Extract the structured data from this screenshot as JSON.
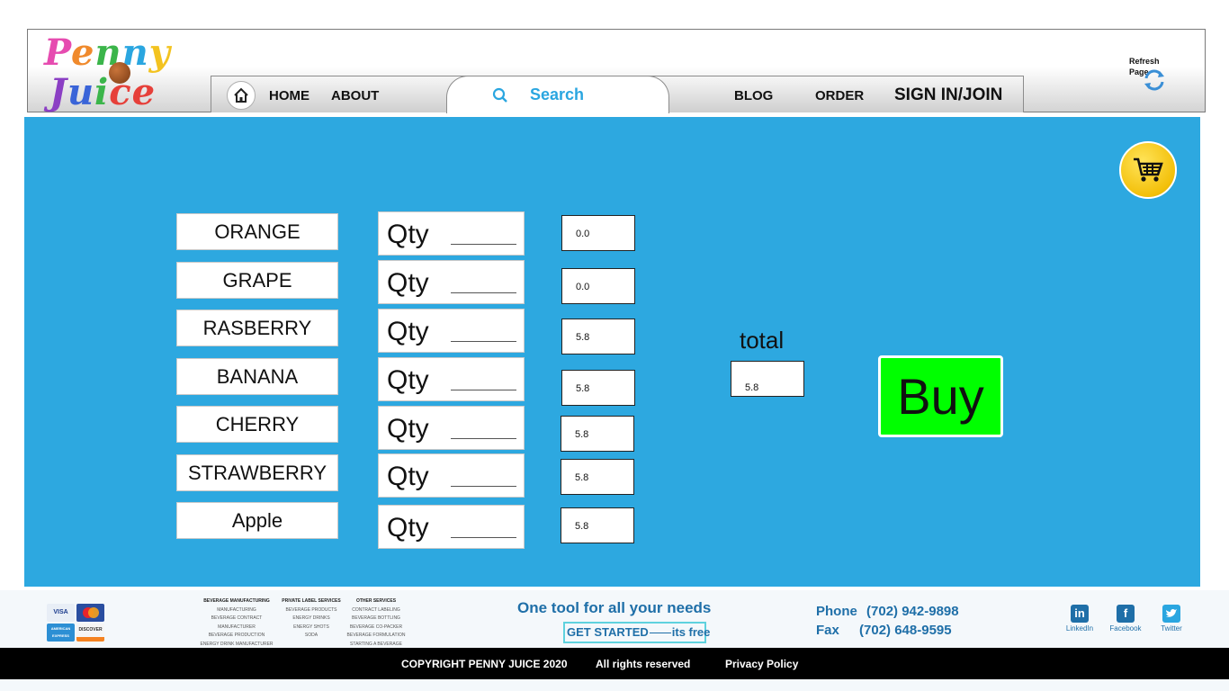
{
  "logo": {
    "line1": "Penny",
    "line2": "Juice"
  },
  "nav": {
    "home": "HOME",
    "about": "ABOUT",
    "search_label": "Search",
    "blog": "BLOG",
    "order": "ORDER",
    "sign_in": "SIGN IN/JOIN"
  },
  "refresh": {
    "line1": "Refresh",
    "line2": "Page"
  },
  "products": [
    {
      "name": "ORANGE",
      "qty_label": "Qty",
      "price": "0.0"
    },
    {
      "name": "GRAPE",
      "qty_label": "Qty",
      "price": "0.0"
    },
    {
      "name": "RASBERRY",
      "qty_label": "Qty",
      "price": "5.8"
    },
    {
      "name": "BANANA",
      "qty_label": "Qty",
      "price": "5.8"
    },
    {
      "name": "CHERRY",
      "qty_label": "Qty",
      "price": "5.8"
    },
    {
      "name": "STRAWBERRY",
      "qty_label": "Qty",
      "price": "5.8"
    },
    {
      "name": "Apple",
      "qty_label": "Qty",
      "price": "5.8"
    }
  ],
  "total": {
    "label": "total",
    "value": "5.8"
  },
  "buy_label": "Buy",
  "footer": {
    "col1": {
      "title": "BEVERAGE MANUFACTURING",
      "items": [
        "MANUFACTURING",
        "BEVERAGE CONTRACT MANUFACTURER",
        "BEVERAGE PRODUCTION",
        "ENERGY DRINK MANUFACTURER"
      ]
    },
    "col2": {
      "title": "PRIVATE LABEL SERVICES",
      "items": [
        "BEVERAGE PRODUCTS",
        "ENERGY DRINKS",
        "ENERGY SHOTS",
        "SODA"
      ]
    },
    "col3": {
      "title": "OTHER SERVICES",
      "items": [
        "CONTRACT LABELING",
        "BEVERAGE BOTTLING",
        "BEVERAGE CO-PACKER",
        "BEVERAGE FORMULATION",
        "STARTING A BEVERAGE BRAND"
      ]
    },
    "tagline": "One tool for all your needs",
    "get_started": "GET STARTED",
    "its_free": "its free",
    "phone_label": "Phone",
    "phone": "(702) 942-9898",
    "fax_label": "Fax",
    "fax": "(702) 648-9595",
    "social": {
      "linkedin": "LinkedIn",
      "facebook": "Facebook",
      "twitter": "Twitter"
    },
    "cards": {
      "visa": "VISA",
      "amex": "AMERICAN EXPRESS",
      "discover": "DISCOVER"
    }
  },
  "copyright": {
    "text": "COPYRIGHT PENNY JUICE  2020",
    "rights": "All rights reserved",
    "privacy": "Privacy Policy"
  }
}
